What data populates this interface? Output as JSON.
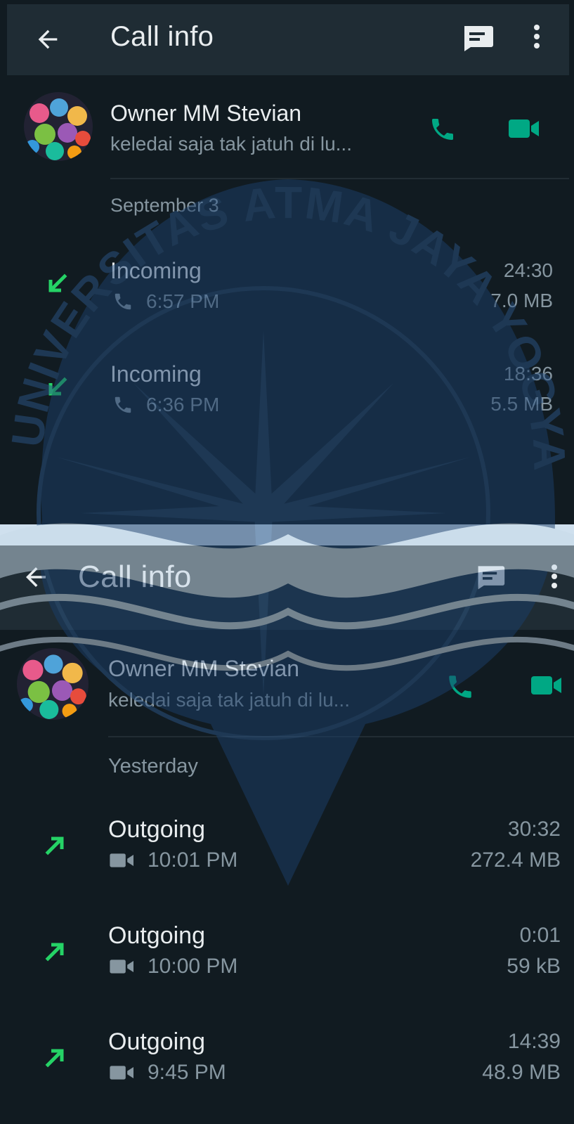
{
  "screens": [
    {
      "title": "Call info",
      "contact": {
        "name": "Owner MM Stevian",
        "status": "keledai saja tak jatuh di lu..."
      },
      "date": "September 3",
      "calls": [
        {
          "type": "Incoming",
          "media": "voice",
          "time": "6:57 PM",
          "duration": "24:30",
          "size": "7.0 MB"
        },
        {
          "type": "Incoming",
          "media": "voice",
          "time": "6:36 PM",
          "duration": "18:36",
          "size": "5.5 MB"
        }
      ]
    },
    {
      "title": "Call info",
      "contact": {
        "name": "Owner MM Stevian",
        "status": "keledai saja tak jatuh di lu..."
      },
      "date": "Yesterday",
      "calls": [
        {
          "type": "Outgoing",
          "media": "video",
          "time": "10:01 PM",
          "duration": "30:32",
          "size": "272.4 MB"
        },
        {
          "type": "Outgoing",
          "media": "video",
          "time": "10:00 PM",
          "duration": "0:01",
          "size": "59 kB"
        },
        {
          "type": "Outgoing",
          "media": "video",
          "time": "9:45 PM",
          "duration": "14:39",
          "size": "48.9 MB"
        }
      ]
    }
  ],
  "watermark": {
    "text": "UNIVERSITAS ATMA JAYA YOGYAKARTA"
  },
  "icons": {
    "back": "arrow-left-icon",
    "message": "message-icon",
    "more": "more-vert-icon",
    "voice_call": "phone-icon",
    "video_call": "videocam-icon",
    "incoming": "arrow-incoming-icon",
    "outgoing": "arrow-outgoing-icon"
  },
  "colors": {
    "background": "#111b21",
    "appbar": "#1f2c34",
    "accent": "#00a884",
    "arrow_green": "#25d366",
    "text_primary": "#e9edef",
    "text_secondary": "#8696a0",
    "watermark": "#1e4a7a"
  }
}
